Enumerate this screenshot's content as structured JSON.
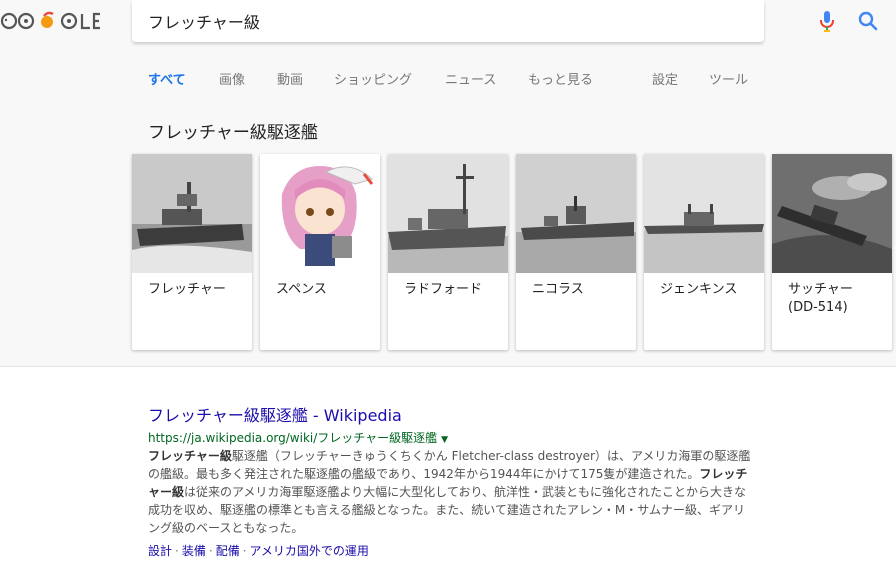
{
  "search": {
    "query": "フレッチャー級"
  },
  "tabs": [
    {
      "label": "すべて"
    },
    {
      "label": "画像"
    },
    {
      "label": "動画"
    },
    {
      "label": "ショッピング"
    },
    {
      "label": "ニュース"
    },
    {
      "label": "もっと見る"
    },
    {
      "label": "設定"
    },
    {
      "label": "ツール"
    }
  ],
  "image_pack": {
    "title": "フレッチャー級駆逐艦",
    "cards": [
      {
        "label": "フレッチャー"
      },
      {
        "label": "スペンス"
      },
      {
        "label": "ラドフォード"
      },
      {
        "label": "ニコラス"
      },
      {
        "label": "ジェンキンス"
      },
      {
        "label": "サッチャー (DD-514)"
      }
    ]
  },
  "result": {
    "title": "フレッチャー級駆逐艦 - Wikipedia",
    "url": "https://ja.wikipedia.org/wiki/フレッチャー級駆逐艦",
    "snippet_bold_1": "フレッチャー級",
    "snippet_1": "駆逐艦（フレッチャーきゅうくちくかん Fletcher-class destroyer）は、アメリカ海軍の駆逐艦の艦級。最も多く発注された駆逐艦の艦級であり、1942年から1944年にかけて175隻が建造された。",
    "snippet_bold_2": "フレッチャー級",
    "snippet_2": "は従来のアメリカ海軍駆逐艦より大幅に大型化しており、航洋性・武装ともに強化されたことから大きな成功を収め、駆逐艦の標準とも言える艦級となった。また、続いて建造されたアレン・M・サムナー級、ギアリング級のベースともなった。",
    "sitelinks": [
      "設計",
      "装備",
      "配備",
      "アメリカ国外での運用"
    ]
  },
  "colors": {
    "link": "#1a0dab",
    "url": "#006621",
    "active_tab": "#1a73e8"
  }
}
